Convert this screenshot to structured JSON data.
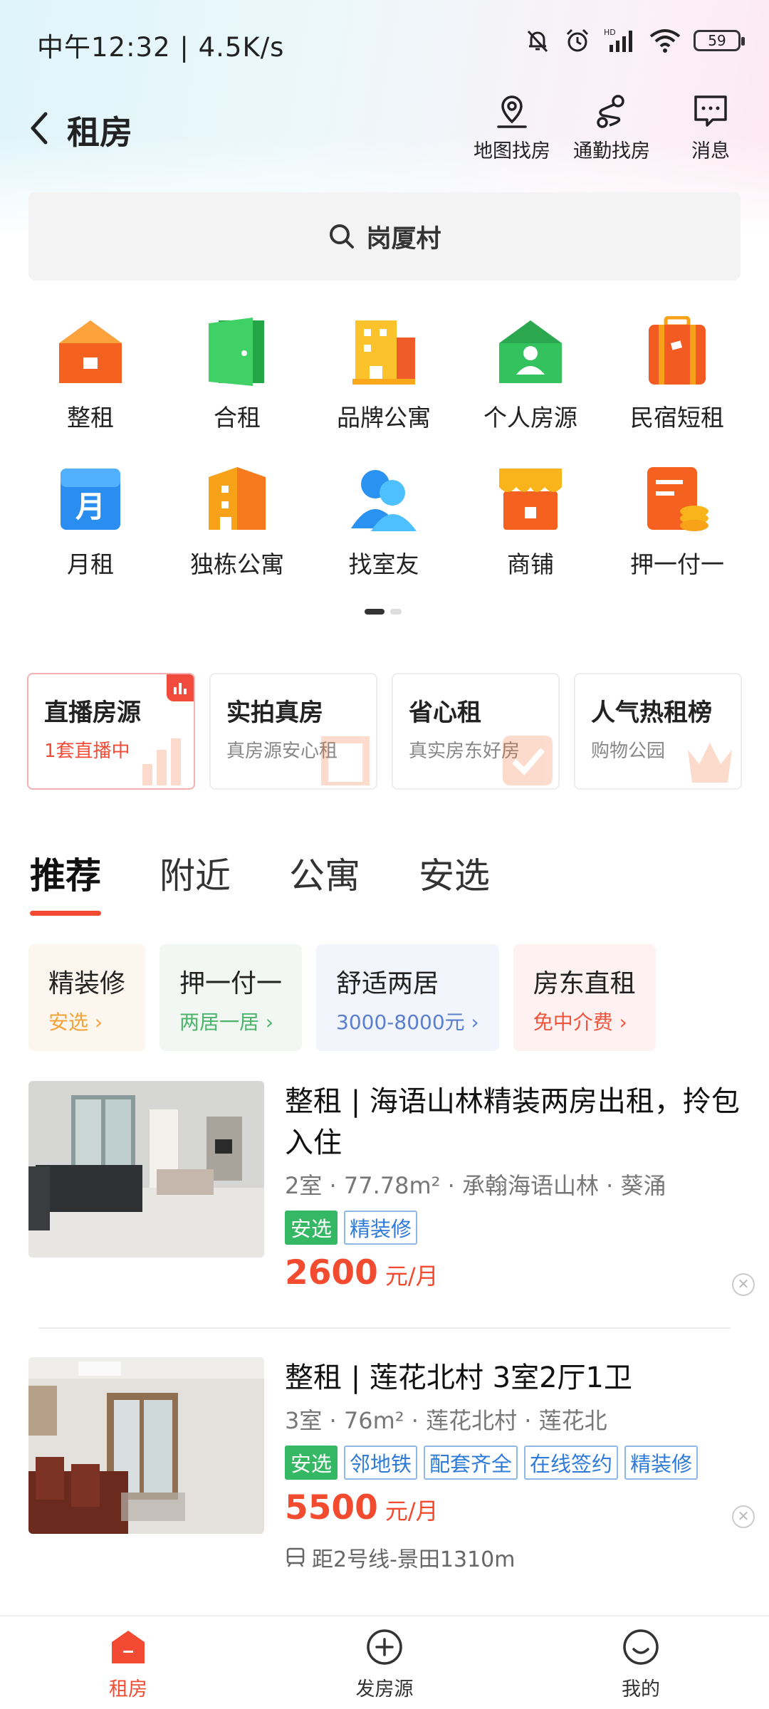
{
  "status_bar": {
    "time": "中午12:32 | 4.5K/s",
    "battery": "59"
  },
  "header": {
    "title": "租房",
    "actions": [
      {
        "label": "地图找房",
        "icon": "map-pin-icon"
      },
      {
        "label": "通勤找房",
        "icon": "route-icon"
      },
      {
        "label": "消息",
        "icon": "message-icon"
      }
    ]
  },
  "search": {
    "query": "岗厦村"
  },
  "categories": [
    {
      "label": "整租",
      "icon": "house-icon",
      "color": "#f5611f"
    },
    {
      "label": "合租",
      "icon": "door-icon",
      "color": "#2fc653"
    },
    {
      "label": "品牌公寓",
      "icon": "building-icon",
      "color": "#f8b41a"
    },
    {
      "label": "个人房源",
      "icon": "person-house-icon",
      "color": "#33c25d"
    },
    {
      "label": "民宿短租",
      "icon": "suitcase-icon",
      "color": "#f25c23"
    },
    {
      "label": "月租",
      "icon": "calendar-icon",
      "color": "#2a8df0"
    },
    {
      "label": "独栋公寓",
      "icon": "tower-icon",
      "color": "#f8a21a"
    },
    {
      "label": "找室友",
      "icon": "roommate-icon",
      "color": "#2a92f0"
    },
    {
      "label": "商铺",
      "icon": "shop-icon",
      "color": "#f7a620"
    },
    {
      "label": "押一付一",
      "icon": "bill-icon",
      "color": "#f5611f"
    }
  ],
  "promo_cards": [
    {
      "title": "直播房源",
      "subtitle": "1套直播中"
    },
    {
      "title": "实拍真房",
      "subtitle": "真房源安心租"
    },
    {
      "title": "省心租",
      "subtitle": "真实房东好房"
    },
    {
      "title": "人气热租榜",
      "subtitle": "购物公园"
    }
  ],
  "tabs": [
    "推荐",
    "附近",
    "公寓",
    "安选"
  ],
  "filter_chips": [
    {
      "title": "精装修",
      "subtitle": "安选 ›",
      "bg": "#fdf6ee",
      "sub_color": "#f2a33a"
    },
    {
      "title": "押一付一",
      "subtitle": "两居一居 ›",
      "bg": "#f3f7f4",
      "sub_color": "#4bb46a"
    },
    {
      "title": "舒适两居",
      "subtitle": "3000-8000元 ›",
      "bg": "#f2f5fb",
      "sub_color": "#5b7fcf"
    },
    {
      "title": "房东直租",
      "subtitle": "免中介费 ›",
      "bg": "#fdf1f1",
      "sub_color": "#f0543d"
    }
  ],
  "listings": [
    {
      "title": "整租 | 海语山林精装两房出租，拎包入住",
      "meta": "2室 · 77.78m² · 承翰海语山林 · 葵涌",
      "tags": [
        "安选",
        "精装修"
      ],
      "price": "2600",
      "unit": "元/月"
    },
    {
      "title": "整租 | 莲花北村 3室2厅1卫",
      "meta": "3室 · 76m² · 莲花北村 · 莲花北",
      "tags": [
        "安选",
        "邻地铁",
        "配套齐全",
        "在线签约",
        "精装修"
      ],
      "price": "5500",
      "unit": "元/月",
      "metro": "距2号线-景田1310m"
    }
  ],
  "bottom_nav": [
    {
      "label": "租房",
      "icon": "home-icon"
    },
    {
      "label": "发房源",
      "icon": "plus-circle-icon"
    },
    {
      "label": "我的",
      "icon": "smile-icon"
    }
  ]
}
